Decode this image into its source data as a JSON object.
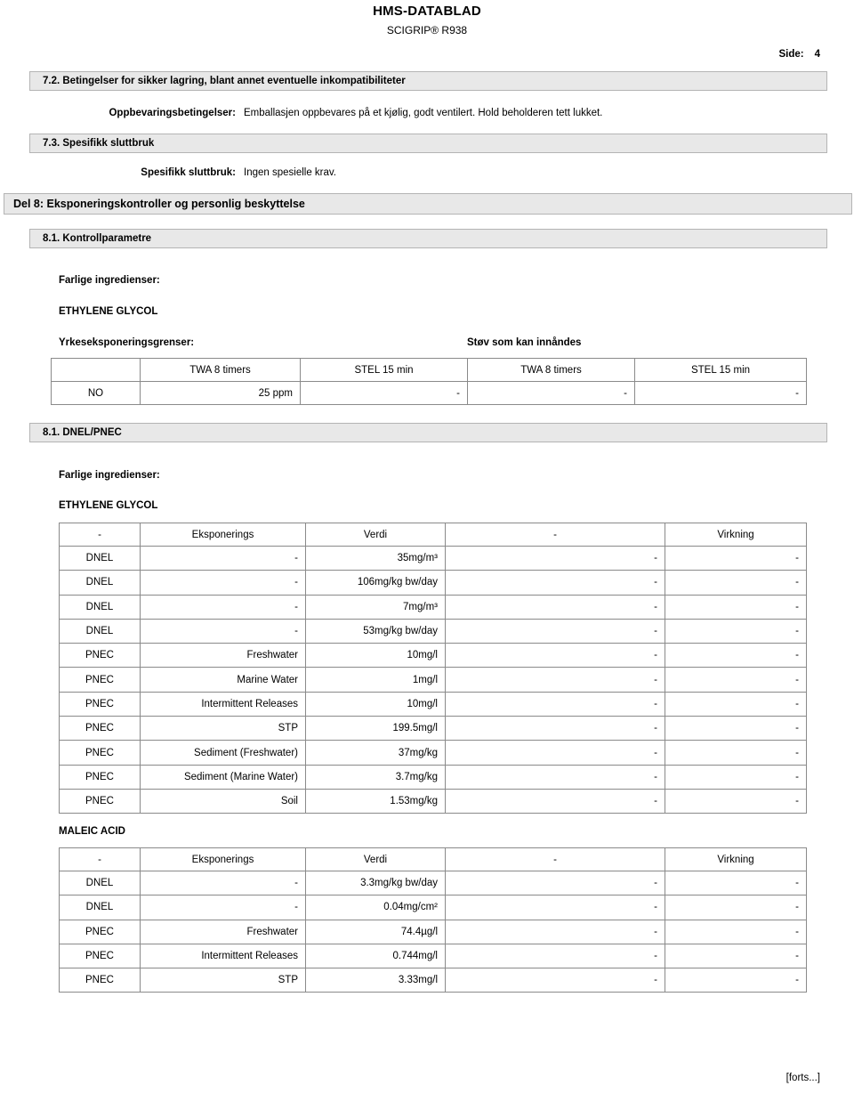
{
  "header": {
    "title": "HMS-DATABLAD",
    "subtitle": "SCIGRIP® R938",
    "page_label": "Side:",
    "page_number": "4"
  },
  "sections": {
    "s72": "7.2. Betingelser for sikker lagring, blant annet eventuelle inkompatibiliteter",
    "s73": "7.3. Spesifikk sluttbruk",
    "del8": "Del 8: Eksponeringskontroller og personlig beskyttelse",
    "s81_kontroll": "8.1. Kontrollparametre",
    "s81_dnel": "8.1. DNEL/PNEC"
  },
  "fields": {
    "storage": {
      "label": "Oppbevaringsbetingelser:",
      "value": "Emballasjen oppbevares på et kjølig, godt ventilert. Hold beholderen tett lukket."
    },
    "specific_use": {
      "label": "Spesifikk sluttbruk:",
      "value": "Ingen spesielle krav."
    }
  },
  "control_parameters": {
    "hazardous_ingredients_label": "Farlige ingredienser:",
    "substance": "ETHYLENE GLYCOL",
    "oel_label": "Yrkeseksponeringsgrenser:",
    "dust_label": "Støv som kan innåndes",
    "table": {
      "headers": [
        "",
        "TWA 8 timers",
        "STEL 15 min",
        "TWA 8 timers",
        "STEL 15 min"
      ],
      "rows": [
        [
          "NO",
          "25 ppm",
          "-",
          "-",
          "-"
        ]
      ]
    }
  },
  "dnel_pnec": {
    "hazardous_ingredients_label": "Farlige ingredienser:",
    "substances": [
      {
        "name": "ETHYLENE GLYCOL",
        "headers": [
          "-",
          "Eksponerings",
          "Verdi",
          "-",
          "Virkning"
        ],
        "rows": [
          [
            "DNEL",
            "-",
            "35mg/m³",
            "-",
            "-"
          ],
          [
            "DNEL",
            "-",
            "106mg/kg bw/day",
            "-",
            "-"
          ],
          [
            "DNEL",
            "-",
            "7mg/m³",
            "-",
            "-"
          ],
          [
            "DNEL",
            "-",
            "53mg/kg bw/day",
            "-",
            "-"
          ],
          [
            "PNEC",
            "Freshwater",
            "10mg/l",
            "-",
            "-"
          ],
          [
            "PNEC",
            "Marine Water",
            "1mg/l",
            "-",
            "-"
          ],
          [
            "PNEC",
            "Intermittent Releases",
            "10mg/l",
            "-",
            "-"
          ],
          [
            "PNEC",
            "STP",
            "199.5mg/l",
            "-",
            "-"
          ],
          [
            "PNEC",
            "Sediment (Freshwater)",
            "37mg/kg",
            "-",
            "-"
          ],
          [
            "PNEC",
            "Sediment (Marine Water)",
            "3.7mg/kg",
            "-",
            "-"
          ],
          [
            "PNEC",
            "Soil",
            "1.53mg/kg",
            "-",
            "-"
          ]
        ]
      },
      {
        "name": "MALEIC ACID",
        "headers": [
          "-",
          "Eksponerings",
          "Verdi",
          "-",
          "Virkning"
        ],
        "rows": [
          [
            "DNEL",
            "-",
            "3.3mg/kg bw/day",
            "-",
            "-"
          ],
          [
            "DNEL",
            "-",
            "0.04mg/cm²",
            "-",
            "-"
          ],
          [
            "PNEC",
            "Freshwater",
            "74.4µg/l",
            "-",
            "-"
          ],
          [
            "PNEC",
            "Intermittent Releases",
            "0.744mg/l",
            "-",
            "-"
          ],
          [
            "PNEC",
            "STP",
            "3.33mg/l",
            "-",
            "-"
          ]
        ]
      }
    ]
  },
  "footer": {
    "continued": "[forts...]"
  }
}
